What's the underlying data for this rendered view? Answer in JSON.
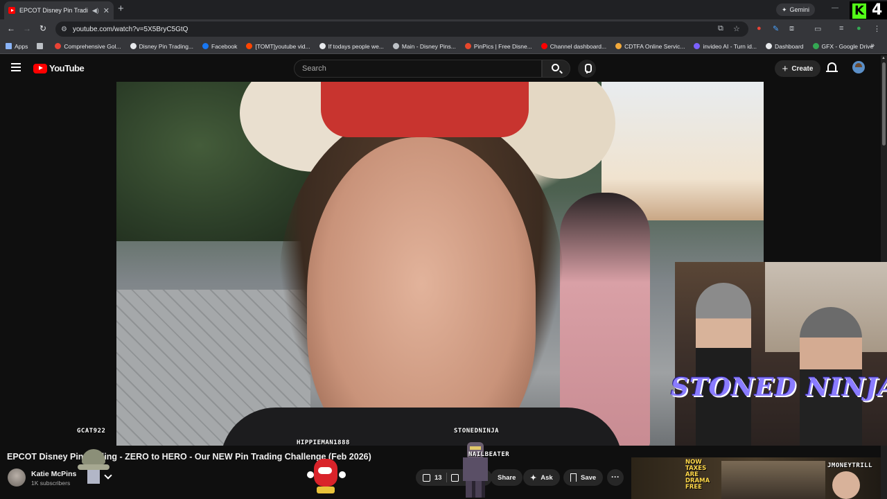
{
  "browser": {
    "tab_title": "EPCOT Disney Pin Trading",
    "tab_speaker_icon": "speaker-icon",
    "new_tab": "+",
    "gemini_label": "Gemini",
    "kick_badge": "4",
    "url": "youtube.com/watch?v=5X5BryC5GtQ",
    "bookmarks": [
      {
        "label": "Apps",
        "color": "#8ab4f8"
      },
      {
        "label": "",
        "color": "#8ab4f8"
      },
      {
        "label": "Comprehensive Gol...",
        "color": "#ea4335"
      },
      {
        "label": "Disney Pin Trading...",
        "color": "#e8eaed"
      },
      {
        "label": "Facebook",
        "color": "#1877f2"
      },
      {
        "label": "[TOMT]youtube vid...",
        "color": "#ff4500"
      },
      {
        "label": "If todays people we...",
        "color": "#e8eaed"
      },
      {
        "label": "Main - Disney Pins...",
        "color": "#bdc1c6"
      },
      {
        "label": "PinPics | Free Disne...",
        "color": "#e8472b"
      },
      {
        "label": "Channel dashboard...",
        "color": "#ff0000"
      },
      {
        "label": "CDTFA Online Servic...",
        "color": "#f2a93b"
      },
      {
        "label": "invideo AI - Turn id...",
        "color": "#7b61ff"
      },
      {
        "label": "Dashboard",
        "color": "#e8eaed"
      },
      {
        "label": "GFX - Google Drive",
        "color": "#34a853"
      }
    ],
    "bookmarks_more": "»"
  },
  "youtube": {
    "logo_text": "YouTube",
    "search_placeholder": "Search",
    "create_label": "Create"
  },
  "overlay": {
    "stream_title": "STONED NINJA",
    "viewers": [
      {
        "name": "GCAT922"
      },
      {
        "name": "HIPPIEMAN1888"
      },
      {
        "name": "STONEDNINJA"
      },
      {
        "name": "NAILBEATER"
      },
      {
        "name": "JMONEYTRILL"
      }
    ],
    "reco_text": "NOW TAXES ARE DRAMA FREE"
  },
  "video": {
    "title": "EPCOT Disney Pin Trading - ZERO to HERO - Our NEW Pin Trading Challenge (Feb 2026)",
    "channel": "Katie McPins",
    "subscribers": "1K subscribers",
    "likes": "13",
    "share_label": "Share",
    "ask_label": "Ask",
    "save_label": "Save",
    "more_label": "···"
  }
}
